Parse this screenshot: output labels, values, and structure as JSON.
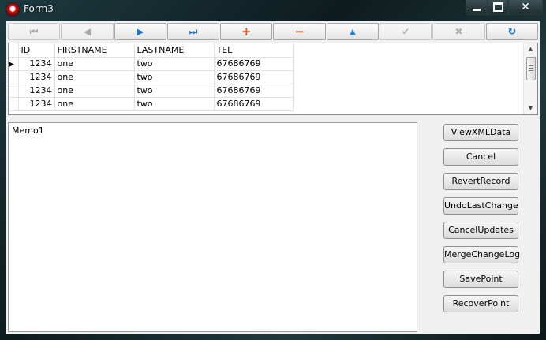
{
  "window": {
    "title": "Form3"
  },
  "navigator": [
    {
      "name": "nav-first",
      "glyph": "⏮",
      "enabled": false
    },
    {
      "name": "nav-prior",
      "glyph": "◀",
      "enabled": false
    },
    {
      "name": "nav-next",
      "glyph": "▶",
      "enabled": true
    },
    {
      "name": "nav-last",
      "glyph": "⏭",
      "enabled": true
    },
    {
      "name": "nav-insert",
      "glyph": "+",
      "enabled": true
    },
    {
      "name": "nav-delete",
      "glyph": "−",
      "enabled": true
    },
    {
      "name": "nav-edit",
      "glyph": "▲",
      "enabled": true
    },
    {
      "name": "nav-post",
      "glyph": "✔",
      "enabled": false
    },
    {
      "name": "nav-cancel",
      "glyph": "✖",
      "enabled": false
    },
    {
      "name": "nav-refresh",
      "glyph": "↻",
      "enabled": true
    }
  ],
  "grid": {
    "columns": [
      "ID",
      "FIRSTNAME",
      "LASTNAME",
      "TEL"
    ],
    "rows": [
      [
        "1234",
        "one",
        "two",
        "67686769"
      ],
      [
        "1234",
        "one",
        "two",
        "67686769"
      ],
      [
        "1234",
        "one",
        "two",
        "67686769"
      ],
      [
        "1234",
        "one",
        "two",
        "67686769"
      ]
    ],
    "current_row": 0
  },
  "memo": {
    "text": "Memo1"
  },
  "buttons": {
    "view_xml_data": "ViewXMLData",
    "cancel": "Cancel",
    "revert_record": "RevertRecord",
    "undo_last_change": "UndoLastChange",
    "cancel_updates": "CancelUpdates",
    "merge_change_log": "MergeChangeLog",
    "save_point": "SavePoint",
    "recover_point": "RecoverPoint"
  },
  "colors": {
    "accent_blue": "#1e73c9",
    "accent_orange": "#e2501c"
  }
}
